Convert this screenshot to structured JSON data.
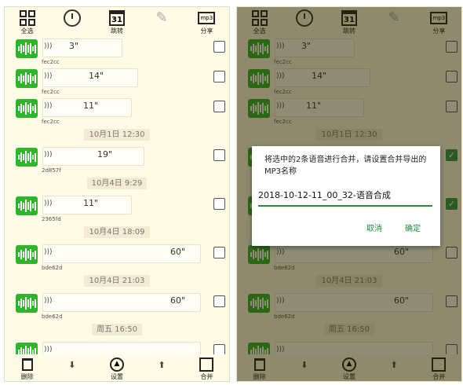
{
  "toolbar": {
    "select_all": "全选",
    "jump": "跳转",
    "calendar_day": "31",
    "share": "分享",
    "mp3_badge": "mp3"
  },
  "bottom": {
    "delete": "删除",
    "settings": "设置",
    "merge": "合并"
  },
  "messages": {
    "m1": {
      "duration": "3\"",
      "sender": "fec2cc"
    },
    "m2": {
      "duration": "14\"",
      "sender": "fec2cc"
    },
    "m3": {
      "duration": "11\"",
      "sender": "fec2cc"
    },
    "t1": "10月1日 12:30",
    "m4": {
      "duration": "19\"",
      "sender": "2d857f"
    },
    "t2": "10月4日 9:29",
    "m5": {
      "duration": "11\"",
      "sender": "2365fd"
    },
    "t3": "10月4日 18:09",
    "m6": {
      "duration": "60\"",
      "sender": "bde62d"
    },
    "t4": "10月4日 21:03",
    "m7": {
      "duration": "60\"",
      "sender": "bde62d"
    },
    "t5": "周五 16:50"
  },
  "dialog": {
    "message": "将选中的2条语音进行合并，请设置合并导出的MP3名称",
    "filename": "2018-10-12-11_00_32-语音合成",
    "cancel": "取消",
    "confirm": "确定"
  },
  "colors": {
    "accent_green": "#2fb52a",
    "background": "#fffbe6"
  }
}
